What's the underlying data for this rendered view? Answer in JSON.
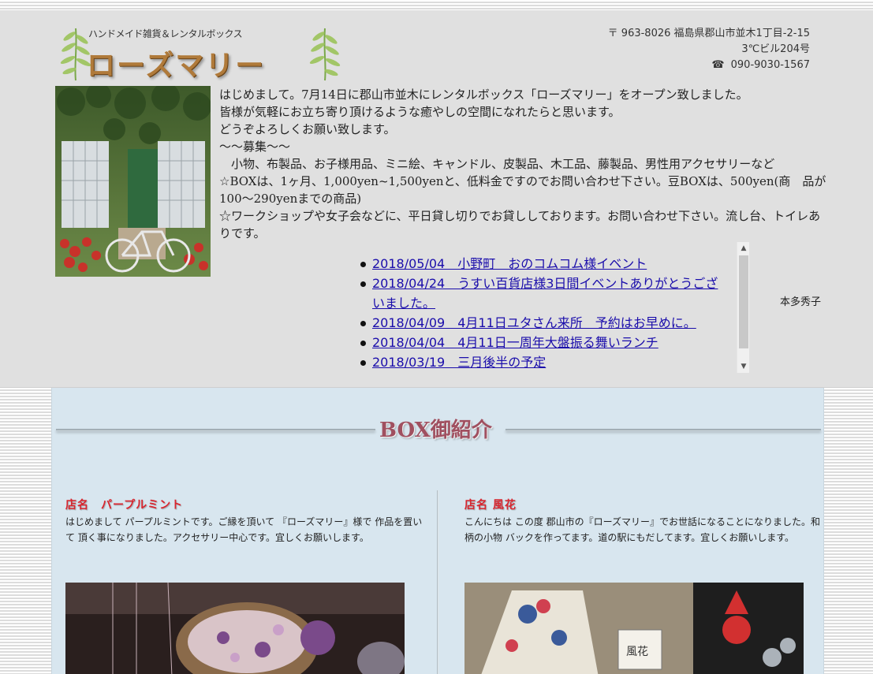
{
  "header": {
    "logo_subtitle": "ハンドメイド雑貨＆レンタルボックス",
    "logo_title": "ローズマリー",
    "address_line1": "〒 963-8026  福島県郡山市並木1丁目-2-15",
    "address_line2": "3℃ビル204号",
    "phone_icon": "phone-icon",
    "phone": "090-9030-1567"
  },
  "intro": {
    "lines": [
      "はじめまして。7月14日に郡山市並木にレンタルボックス「ローズマリー」をオープン致しました。",
      "皆様が気軽にお立ち寄り頂けるような癒やしの空間になれたらと思います。",
      "どうぞよろしくお願い致します。",
      "～～募集～～",
      "　小物、布製品、お子様用品、ミニ絵、キャンドル、皮製品、木工品、藤製品、男性用アクセサリーなど",
      "☆BOXは、1ヶ月、1,000yen~1,500yenと、低料金ですのでお問い合わせ下さい。豆BOXは、500yen(商　品が",
      "100～290yenまでの商品)",
      "☆ワークショップや女子会などに、平日貸し切りでお貸ししております。お問い合わせ下さい。流し台、トイレありです。"
    ]
  },
  "news": {
    "items": [
      "2018/05/04　小野町　おのコムコム様イベント",
      "2018/04/24　うすい百貨店様3日間イベントありがとうございました。",
      "2018/04/09　4月11日ユタさん来所　予約はお早めに。",
      "2018/04/04　4月11日一周年大盤振る舞いランチ",
      "2018/03/19　三月後半の予定"
    ]
  },
  "owner": "本多秀子",
  "box_section": {
    "title": "BOX御紹介",
    "shops": [
      {
        "name": "店名　パープルミント",
        "description": "はじめまして パープルミントです。ご縁を頂いて 『ローズマリー』様で 作品を置いて 頂く事になりました。アクセサリー中心です。宜しくお願いします。"
      },
      {
        "name": "店名 風花",
        "description": "こんにちは この度 郡山市の『ローズマリー』でお世話になることになりました。和柄の小物 バックを作ってます。道の駅にもだしてます。宜しくお願いします。"
      }
    ]
  }
}
